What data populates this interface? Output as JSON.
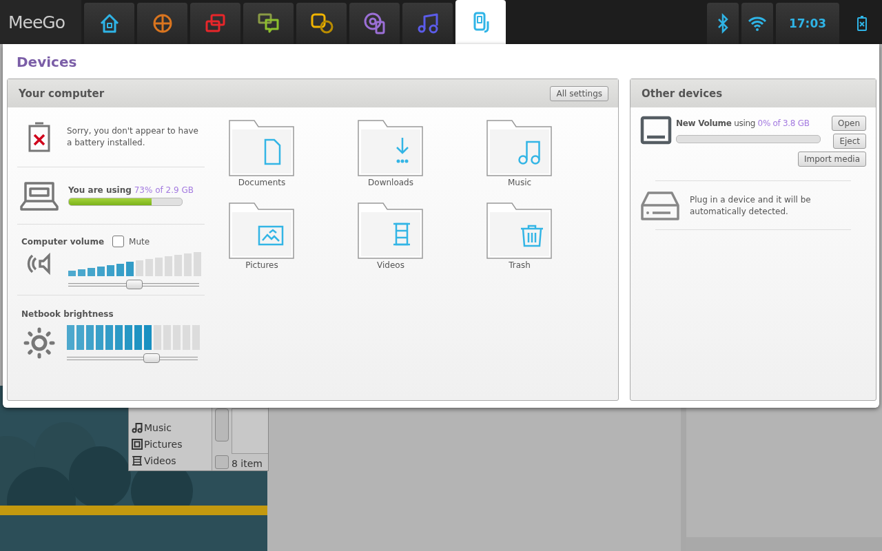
{
  "top_bar": {
    "logo": "MeeGo",
    "zones": [
      {
        "kind": "home",
        "selected": false
      },
      {
        "kind": "web",
        "selected": false
      },
      {
        "kind": "windows",
        "selected": false
      },
      {
        "kind": "chat",
        "selected": false
      },
      {
        "kind": "people",
        "selected": false
      },
      {
        "kind": "media",
        "selected": false
      },
      {
        "kind": "music",
        "selected": false
      },
      {
        "kind": "devices",
        "selected": true
      }
    ],
    "time": "17:03"
  },
  "panel": {
    "title": "Devices",
    "your_computer": {
      "heading": "Your computer",
      "settings_button": "All settings",
      "battery_message": "Sorry, you don't appear to have a battery installed.",
      "storage": {
        "label": "You are using",
        "usage": "73% of 2.9 GB",
        "level": 0.73
      },
      "volume": {
        "label": "Computer volume",
        "mute": {
          "label": "Mute",
          "checked": false
        },
        "level": 0.5
      },
      "brightness": {
        "label": "Netbook brightness",
        "level": 0.64
      },
      "folders": [
        {
          "name": "Documents",
          "kind": "document"
        },
        {
          "name": "Downloads",
          "kind": "download"
        },
        {
          "name": "Music",
          "kind": "music"
        },
        {
          "name": "Pictures",
          "kind": "picture"
        },
        {
          "name": "Videos",
          "kind": "video"
        },
        {
          "name": "Trash",
          "kind": "trash"
        }
      ]
    },
    "other_devices": {
      "heading": "Other devices",
      "devices": [
        {
          "name": "New Volume",
          "using": "using",
          "usage": "0% of 3.8 GB",
          "buttons": [
            "Open",
            "Eject",
            "Import media"
          ]
        }
      ],
      "plug_message": "Plug in a device and it will be automatically detected."
    }
  },
  "file_manager": {
    "places": [
      {
        "name": "Music",
        "kind": "music"
      },
      {
        "name": "Pictures",
        "kind": "picture"
      },
      {
        "name": "Videos",
        "kind": "video"
      }
    ],
    "status": "8 item"
  }
}
